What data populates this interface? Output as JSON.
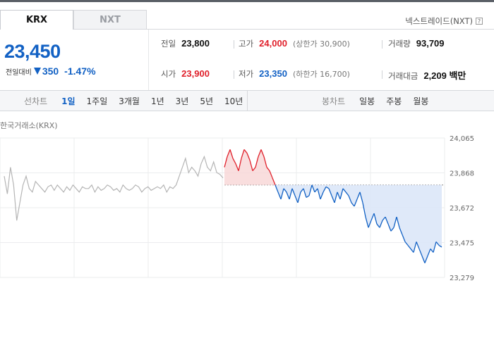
{
  "tabs": [
    {
      "label": "KRX",
      "active": true
    },
    {
      "label": "NXT",
      "active": false
    }
  ],
  "nxt_link": "넥스트레이드(NXT)",
  "quote": {
    "price": "23,450",
    "change_label": "전일대비",
    "change_abs": "350",
    "change_pct": "-1.47%",
    "direction": "down"
  },
  "stats": {
    "prev_close": {
      "label": "전일",
      "value": "23,800"
    },
    "high": {
      "label": "고가",
      "value": "24,000",
      "sub": "(상한가 30,900)"
    },
    "volume": {
      "label": "거래량",
      "value": "93,709"
    },
    "open": {
      "label": "시가",
      "value": "23,900"
    },
    "low": {
      "label": "저가",
      "value": "23,350",
      "sub": "(하한가 16,700)"
    },
    "amount": {
      "label": "거래대금",
      "value": "2,209 백만"
    }
  },
  "controls": {
    "line_label": "선차트",
    "line_periods": [
      "1일",
      "1주일",
      "3개월",
      "1년",
      "3년",
      "5년",
      "10년"
    ],
    "active_period": "1일",
    "candle_label": "봉차트",
    "candle_periods": [
      "일봉",
      "주봉",
      "월봉"
    ]
  },
  "chart_title": "한국거래소(KRX)",
  "colors": {
    "up": "#e0202b",
    "down": "#1261c4",
    "pre": "#b5b5b5",
    "fill_down": "#dbe7f8",
    "fill_up": "#f8d6d6"
  },
  "chart_data": {
    "type": "line",
    "y_ticks": [
      "24,065",
      "23,868",
      "23,672",
      "23,475",
      "23,279"
    ],
    "ylim": [
      23279,
      24065
    ],
    "reference": 23800,
    "pre_market": [
      23850,
      23750,
      23900,
      23800,
      23600,
      23700,
      23800,
      23850,
      23780,
      23760,
      23820,
      23800,
      23780,
      23760,
      23790,
      23800,
      23770,
      23800,
      23780,
      23760,
      23790,
      23770,
      23800,
      23780,
      23760,
      23790,
      23780,
      23780,
      23800,
      23760,
      23790,
      23770,
      23780,
      23800,
      23790,
      23770,
      23780,
      23760,
      23800,
      23780,
      23770,
      23780,
      23800,
      23790,
      23760,
      23780,
      23790,
      23770,
      23780,
      23790,
      23780,
      23800,
      23760,
      23790,
      23780,
      23800,
      23850,
      23900,
      23950,
      23870,
      23900,
      23880,
      23850,
      23920,
      23960,
      23900,
      23880,
      23930,
      23870,
      23860,
      23840
    ],
    "regular": [
      23900,
      23960,
      24000,
      23950,
      23920,
      23880,
      23950,
      24000,
      23980,
      23940,
      23880,
      23900,
      23960,
      24000,
      23960,
      23900,
      23880,
      23840,
      23800,
      23760,
      23720,
      23780,
      23760,
      23720,
      23780,
      23740,
      23700,
      23760,
      23780,
      23730,
      23740,
      23800,
      23760,
      23780,
      23720,
      23760,
      23790,
      23780,
      23740,
      23700,
      23760,
      23720,
      23780,
      23760,
      23740,
      23700,
      23680,
      23720,
      23760,
      23700,
      23620,
      23560,
      23600,
      23640,
      23580,
      23560,
      23600,
      23620,
      23580,
      23540,
      23560,
      23620,
      23560,
      23520,
      23480,
      23460,
      23440,
      23420,
      23480,
      23440,
      23400,
      23360,
      23400,
      23440,
      23420,
      23480,
      23460,
      23450
    ]
  }
}
